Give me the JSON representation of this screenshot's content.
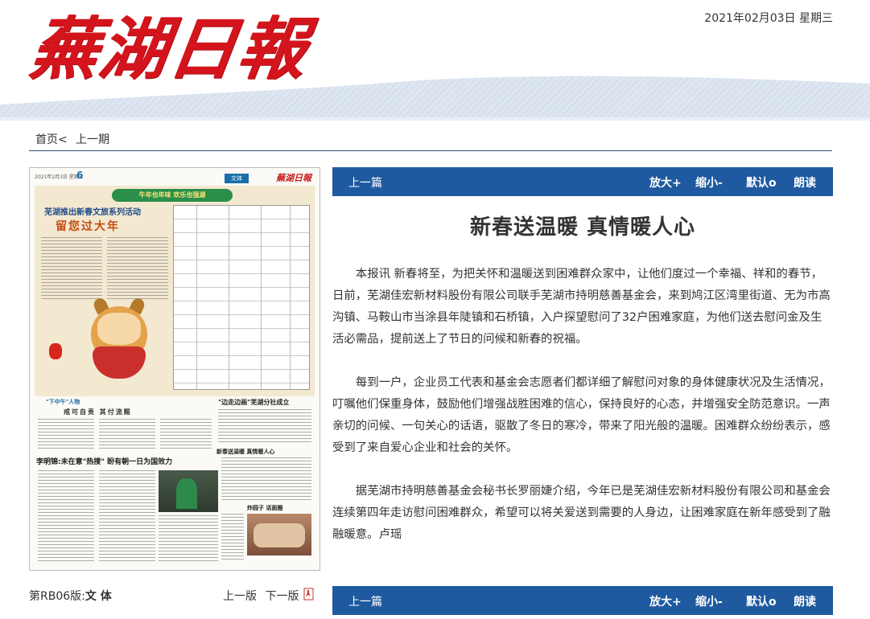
{
  "header": {
    "masthead": "蕪湖日報",
    "date": "2021年02月03日 星期三"
  },
  "nav": {
    "home": "首页<",
    "prev_issue": "上一期"
  },
  "thumbnail": {
    "date": "2021年2月3日 星期三",
    "page_num": "6",
    "section_tag": "文体",
    "logo": "蕪湖日報",
    "banner": "牛年也年味  欢乐也强湖",
    "upper_title": "芜湖推出新春文旅系列活动",
    "upper_subtitle": "留您过大年",
    "lower_kicker": "\"下中午\"人物",
    "lower_slogan": "戒可自责  其付流赐",
    "lower_headline": "李明锦:未在意\"热搜\" 盼有朝一日为国效力",
    "right_head": "\"边走边画\"芜湖分社成立",
    "right_sub": "新春送温暖 真情暖人心",
    "right_sub2": "炸园子 话面圈"
  },
  "page": {
    "label_prefix": "第RB06版:",
    "label_name": "文 体",
    "prev_page": "上一版",
    "next_page": "下一版",
    "pdf_icon": "pdf-icon"
  },
  "toolbar": {
    "prev_article": "上一篇",
    "zoom_in": "放大+",
    "zoom_out": "缩小-",
    "default": "默认o",
    "read_aloud": "朗读"
  },
  "article": {
    "title": "新春送温暖  真情暖人心",
    "paragraphs": [
      "本报讯 新春将至，为把关怀和温暖送到困难群众家中，让他们度过一个幸福、祥和的春节，日前，芜湖佳宏新材料股份有限公司联手芜湖市持明慈善基金会，来到鸠江区湾里街道、无为市高沟镇、马鞍山市当涂县年陡镇和石桥镇，入户探望慰问了32户困难家庭，为他们送去慰问金及生活必需品，提前送上了节日的问候和新春的祝福。",
      "每到一户，企业员工代表和基金会志愿者们都详细了解慰问对象的身体健康状况及生活情况，叮嘱他们保重身体，鼓励他们增强战胜困难的信心，保持良好的心态，并增强安全防范意识。一声亲切的问候、一句关心的话语，驱散了冬日的寒冷，带来了阳光般的温暖。困难群众纷纷表示，感受到了来自爱心企业和社会的关怀。",
      "据芜湖市持明慈善基金会秘书长罗丽婕介绍，今年已是芜湖佳宏新材料股份有限公司和基金会连续第四年走访慰问困难群众，希望可以将关爱送到需要的人身边，让困难家庭在新年感受到了融融暖意。卢瑶"
    ]
  },
  "colors": {
    "masthead_red": "#d4141c",
    "toolbar_blue": "#1f5aa0",
    "header_stripe": "#dfe8f2"
  }
}
